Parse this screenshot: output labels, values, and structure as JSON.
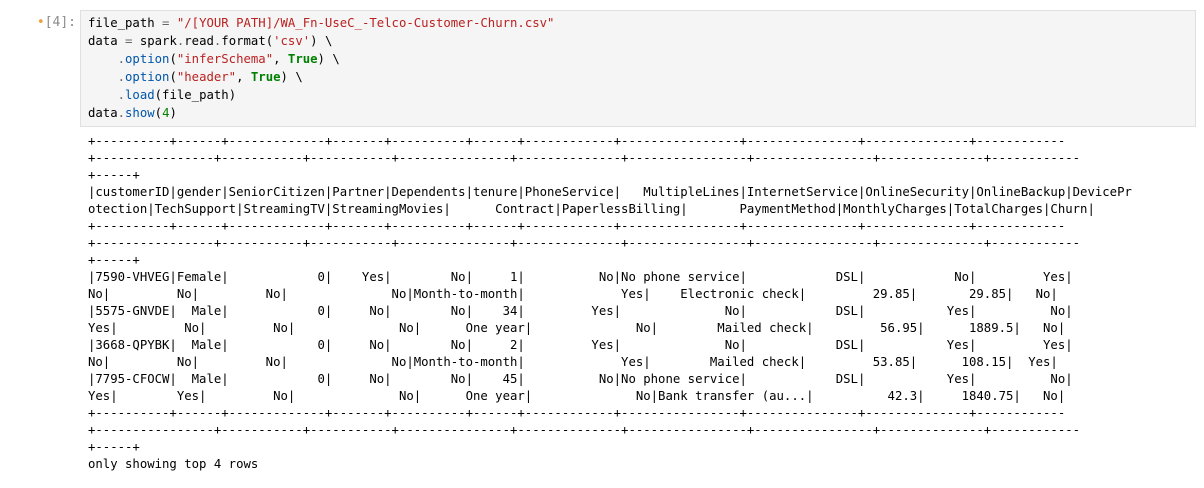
{
  "cell": {
    "prompt_marker": "•",
    "prompt_label": "[4]:",
    "code": {
      "line1": {
        "var": "file_path ",
        "eq": "=",
        "str": " \"/[YOUR PATH]/WA_Fn-UseC_-Telco-Customer-Churn.csv\""
      },
      "line2": {
        "a": "data ",
        "eq": "=",
        "b": " spark",
        "dot1": ".",
        "read": "read",
        "dot2": ".",
        "format": "format",
        "open": "(",
        "str": "'csv'",
        "close": ") \\"
      },
      "line3": {
        "indent": "    ",
        "dot": ".",
        "option": "option",
        "open": "(",
        "str": "\"inferSchema\"",
        "comma": ", ",
        "kw": "True",
        "close": ") \\"
      },
      "line4": {
        "indent": "    ",
        "dot": ".",
        "option": "option",
        "open": "(",
        "str": "\"header\"",
        "comma": ", ",
        "kw": "True",
        "close": ") \\"
      },
      "line5": {
        "indent": "    ",
        "dot": ".",
        "load": "load",
        "args": "(file_path)"
      },
      "line6": {
        "a": "data",
        "dot": ".",
        "show": "show",
        "open": "(",
        "num": "4",
        "close": ")"
      }
    },
    "output_lines": [
      "+----------+------+-------------+-------+----------+------+------------+----------------+---------------+--------------+------------",
      "+----------------+-----------+-----------+---------------+--------------+----------------+----------------+--------------+------------",
      "+-----+",
      "|customerID|gender|SeniorCitizen|Partner|Dependents|tenure|PhoneService|   MultipleLines|InternetService|OnlineSecurity|OnlineBackup|DevicePr",
      "otection|TechSupport|StreamingTV|StreamingMovies|      Contract|PaperlessBilling|       PaymentMethod|MonthlyCharges|TotalCharges|Churn|",
      "+----------+------+-------------+-------+----------+------+------------+----------------+---------------+--------------+------------",
      "+----------------+-----------+-----------+---------------+--------------+----------------+----------------+--------------+------------",
      "+-----+",
      "|7590-VHVEG|Female|            0|    Yes|        No|     1|          No|No phone service|            DSL|            No|         Yes|",
      "No|         No|         No|              No|Month-to-month|             Yes|    Electronic check|         29.85|       29.85|   No|",
      "|5575-GNVDE|  Male|            0|     No|        No|    34|         Yes|              No|            DSL|           Yes|          No|",
      "Yes|         No|         No|              No|      One year|              No|        Mailed check|         56.95|      1889.5|   No|",
      "|3668-QPYBK|  Male|            0|     No|        No|     2|         Yes|              No|            DSL|           Yes|         Yes|",
      "No|         No|         No|              No|Month-to-month|             Yes|        Mailed check|         53.85|      108.15|  Yes|",
      "|7795-CFOCW|  Male|            0|     No|        No|    45|          No|No phone service|            DSL|           Yes|          No|",
      "Yes|        Yes|         No|              No|      One year|              No|Bank transfer (au...|          42.3|     1840.75|   No|",
      "+----------+------+-------------+-------+----------+------+------------+----------------+---------------+--------------+------------",
      "+----------------+-----------+-----------+---------------+--------------+----------------+----------------+--------------+------------",
      "+-----+",
      "only showing top 4 rows"
    ]
  }
}
